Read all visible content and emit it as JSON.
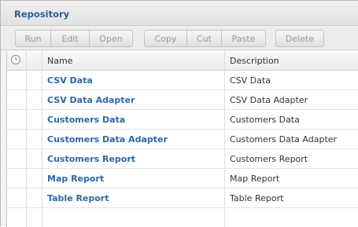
{
  "panel": {
    "title": "Repository"
  },
  "toolbar": {
    "buttons": [
      {
        "label": "Run"
      },
      {
        "label": "Edit"
      },
      {
        "label": "Open"
      },
      {
        "label": "Copy"
      },
      {
        "label": "Cut"
      },
      {
        "label": "Paste"
      },
      {
        "label": "Delete"
      }
    ]
  },
  "table": {
    "columns": {
      "status_icon": "clock-icon",
      "name": "Name",
      "description": "Description"
    },
    "rows": [
      {
        "name": "CSV Data",
        "description": "CSV Data"
      },
      {
        "name": "CSV Data Adapter",
        "description": "CSV Data Adapter"
      },
      {
        "name": "Customers Data",
        "description": "Customers Data"
      },
      {
        "name": "Customers Data Adapter",
        "description": "Customers Data Adapter"
      },
      {
        "name": "Customers Report",
        "description": "Customers Report"
      },
      {
        "name": "Map Report",
        "description": "Map Report"
      },
      {
        "name": "Table Report",
        "description": "Table Report"
      }
    ]
  },
  "colors": {
    "title": "#2c5d9b",
    "link": "#2f67a6",
    "disabled_text": "#9a9a9a"
  }
}
